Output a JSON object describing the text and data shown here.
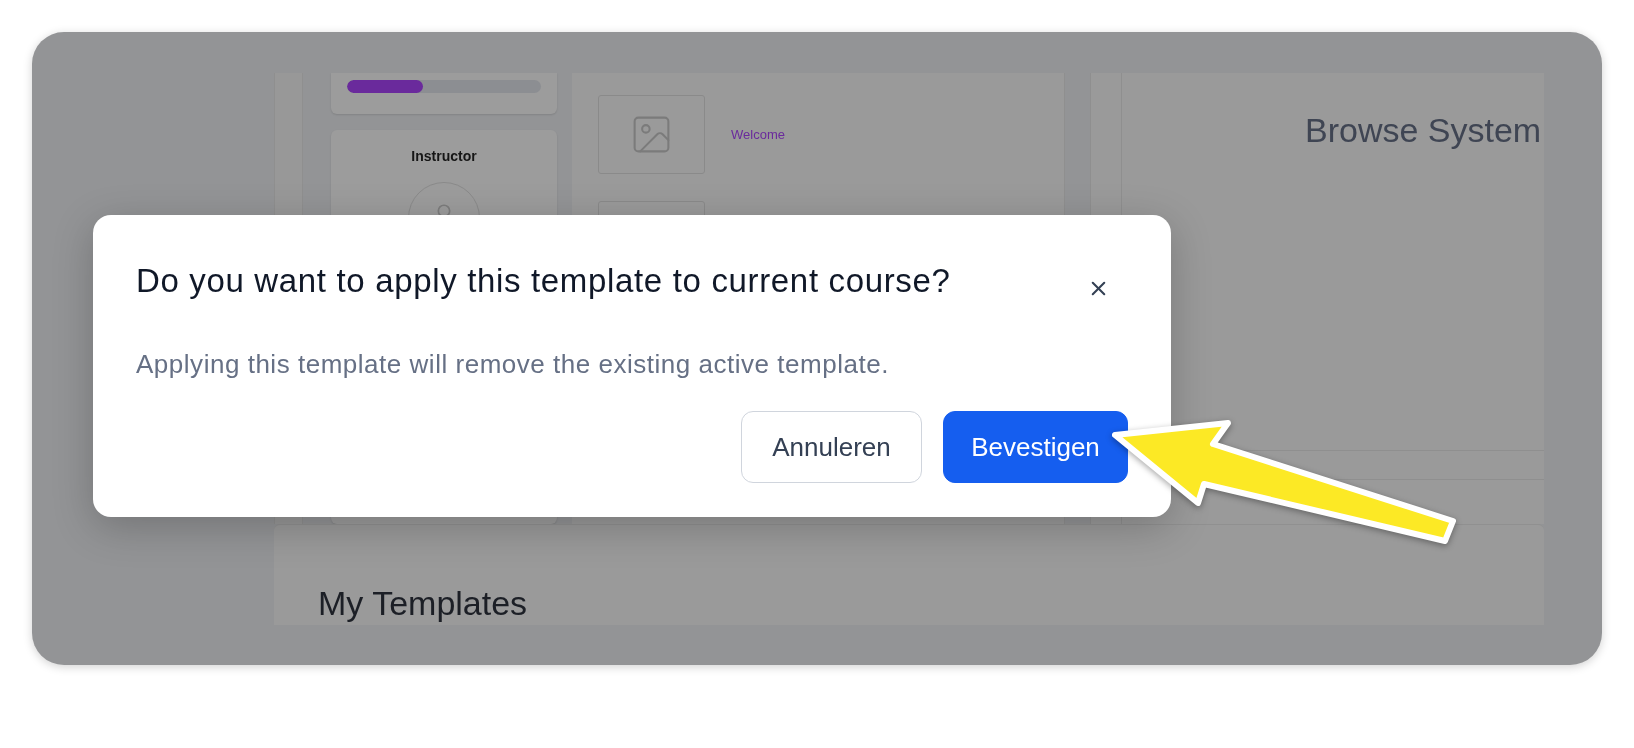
{
  "background": {
    "progress": {
      "level": 0.39
    },
    "instructor_card": {
      "title": "Instructor"
    },
    "lesson": {
      "title": "Welcome"
    },
    "browse_panel": {
      "title": "Browse System"
    },
    "templates_panel": {
      "title": "My Templates"
    }
  },
  "dialog": {
    "title": "Do you want to apply this template to current course?",
    "message": "Applying this template will remove the existing active template.",
    "buttons": [
      {
        "label": "Annuleren",
        "kind": "secondary"
      },
      {
        "label": "Bevestigen",
        "kind": "primary"
      }
    ]
  }
}
